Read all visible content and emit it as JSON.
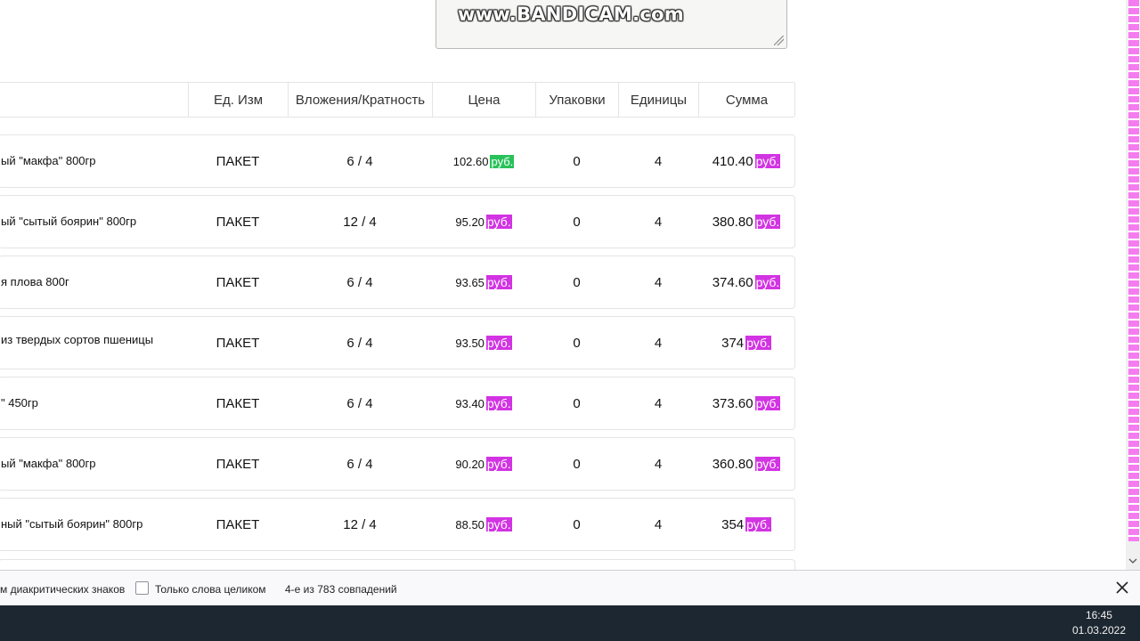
{
  "watermark": "www.BANDICAM.com",
  "table": {
    "headers": [
      "Ед. Изм",
      "Вложения/Кратность",
      "Цена",
      "Упаковки",
      "Единицы",
      "Сумма"
    ],
    "currency": "руб.",
    "rows": [
      {
        "name": "ый \"макфа\" 800гр",
        "unit": "ПАКЕТ",
        "nesting": "6 / 4",
        "price": "102.60",
        "price_badge": "green",
        "packs": "0",
        "units": "4",
        "sum": "410.40"
      },
      {
        "name": "ый \"сытый боярин\" 800гр",
        "unit": "ПАКЕТ",
        "nesting": "12 / 4",
        "price": "95.20",
        "price_badge": "magenta",
        "packs": "0",
        "units": "4",
        "sum": "380.80"
      },
      {
        "name": "я плова 800г",
        "unit": "ПАКЕТ",
        "nesting": "6 / 4",
        "price": "93.65",
        "price_badge": "magenta",
        "packs": "0",
        "units": "4",
        "sum": "374.60"
      },
      {
        "name": " из твердых сортов пшеницы",
        "unit": "ПАКЕТ",
        "nesting": "6 / 4",
        "price": "93.50",
        "price_badge": "magenta",
        "packs": "0",
        "units": "4",
        "sum": "374"
      },
      {
        "name": "\" 450гр",
        "unit": "ПАКЕТ",
        "nesting": "6 / 4",
        "price": "93.40",
        "price_badge": "magenta",
        "packs": "0",
        "units": "4",
        "sum": "373.60"
      },
      {
        "name": "ый \"макфа\" 800гр",
        "unit": "ПАКЕТ",
        "nesting": "6 / 4",
        "price": "90.20",
        "price_badge": "magenta",
        "packs": "0",
        "units": "4",
        "sum": "360.80"
      },
      {
        "name": "ный \"сытый боярин\" 800гр",
        "unit": "ПАКЕТ",
        "nesting": "12 / 4",
        "price": "88.50",
        "price_badge": "magenta",
        "packs": "0",
        "units": "4",
        "sum": "354"
      }
    ]
  },
  "findbar": {
    "diacritics_label": "м диакритических знаков",
    "whole_words_label": "Только слова целиком",
    "match_status": "4-е из 783 совпадений"
  },
  "taskbar": {
    "time": "16:45",
    "date": "01.03.2022"
  },
  "colors": {
    "rub_green": "#29c25a",
    "rub_magenta": "#d233e3",
    "scroll_marks": "#f57cf0",
    "taskbar": "#1d2731"
  }
}
